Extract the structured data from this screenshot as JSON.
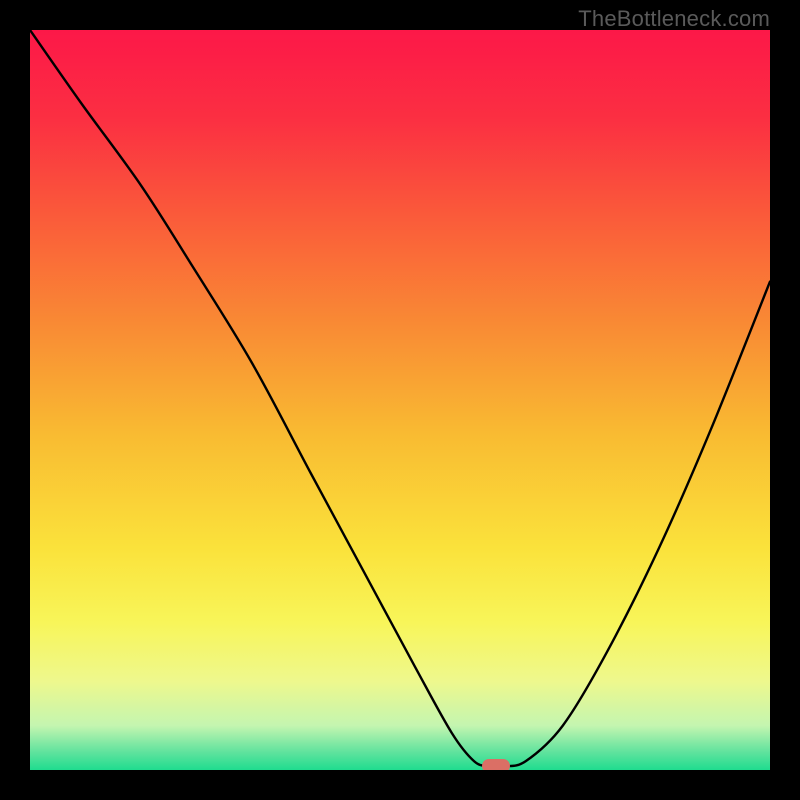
{
  "watermark": "TheBottleneck.com",
  "colors": {
    "frame": "#000000",
    "gradient_stops": [
      {
        "offset": 0.0,
        "color": "#fc1848"
      },
      {
        "offset": 0.12,
        "color": "#fb2f42"
      },
      {
        "offset": 0.25,
        "color": "#fa5a3a"
      },
      {
        "offset": 0.4,
        "color": "#f98b34"
      },
      {
        "offset": 0.55,
        "color": "#f9bc32"
      },
      {
        "offset": 0.7,
        "color": "#fae23b"
      },
      {
        "offset": 0.8,
        "color": "#f8f559"
      },
      {
        "offset": 0.88,
        "color": "#eef88d"
      },
      {
        "offset": 0.94,
        "color": "#c4f5b0"
      },
      {
        "offset": 0.975,
        "color": "#62e39e"
      },
      {
        "offset": 1.0,
        "color": "#1fdc8f"
      }
    ],
    "curve": "#000000",
    "marker": "#db6f65"
  },
  "chart_data": {
    "type": "line",
    "title": "",
    "xlabel": "",
    "ylabel": "",
    "xlim": [
      0,
      100
    ],
    "ylim": [
      0,
      100
    ],
    "legend": false,
    "grid": false,
    "series": [
      {
        "name": "bottleneck-curve",
        "x": [
          0,
          7,
          15,
          22,
          30,
          38,
          45,
          52,
          57,
          60,
          62,
          64,
          67,
          72,
          78,
          85,
          92,
          100
        ],
        "y": [
          100,
          90,
          79,
          68,
          55,
          40,
          27,
          14,
          5,
          1.2,
          0.5,
          0.5,
          1.2,
          6,
          16,
          30,
          46,
          66
        ]
      }
    ],
    "marker": {
      "x": 63,
      "y": 0.5
    }
  }
}
